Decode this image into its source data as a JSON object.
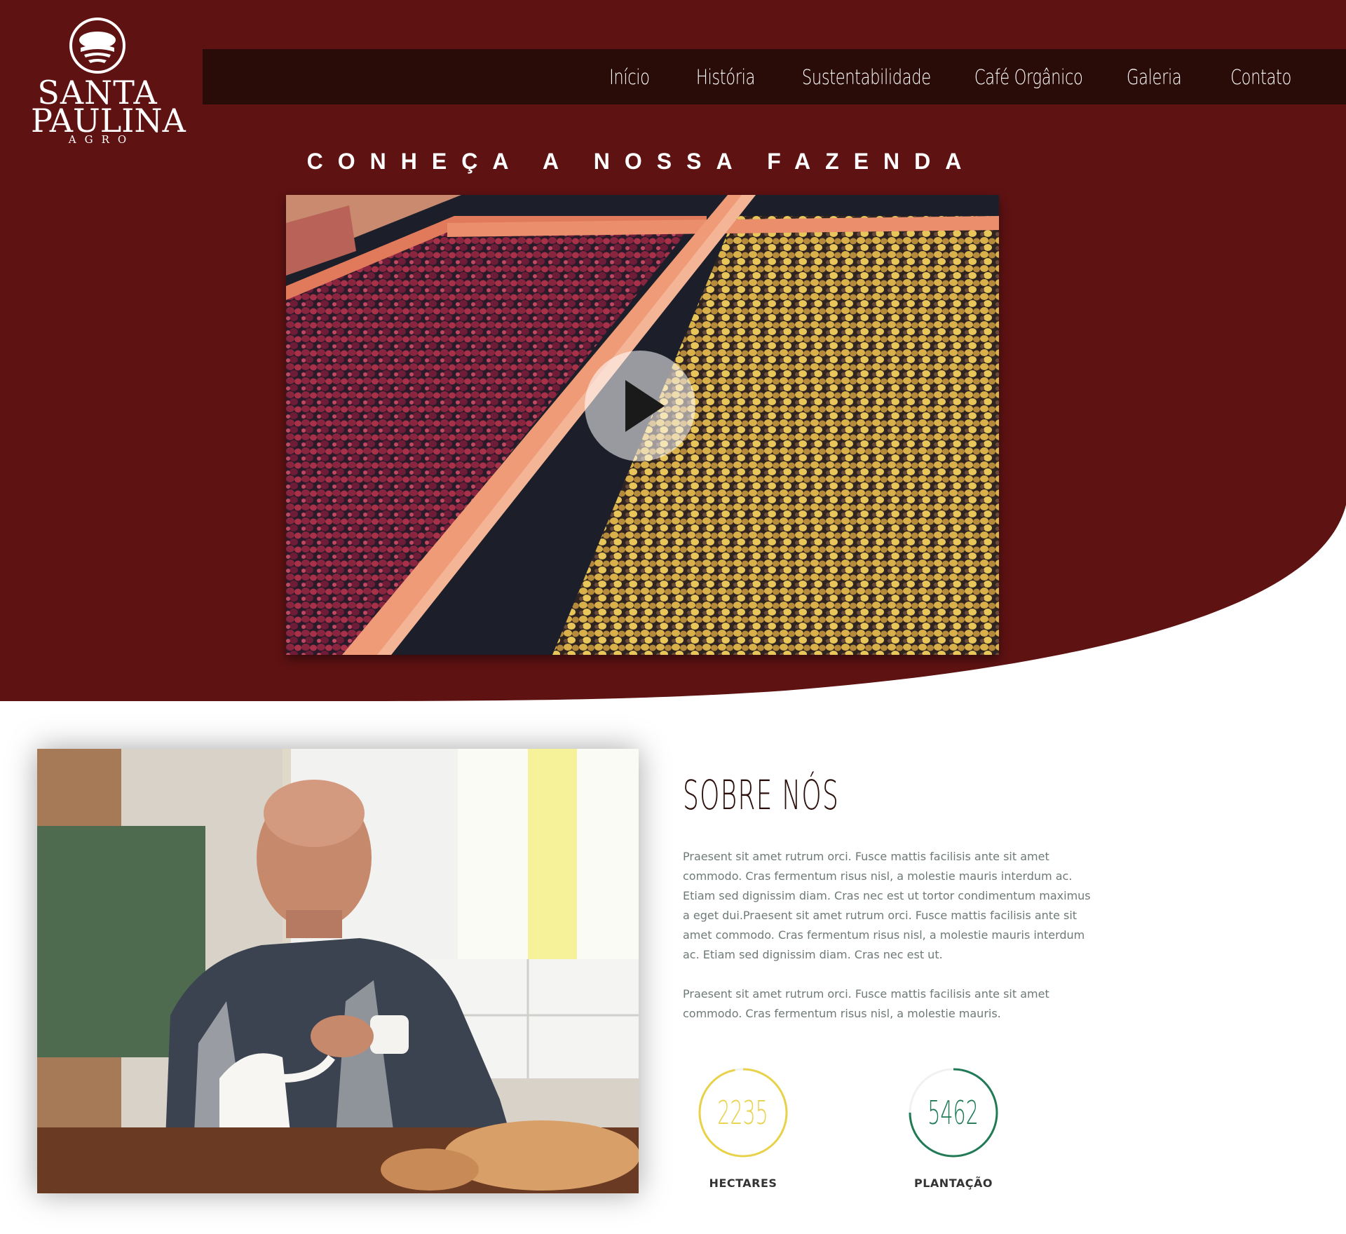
{
  "brand": {
    "line1": "SANTA",
    "line2": "PAULINA",
    "line3": "AGRO"
  },
  "nav": {
    "items": [
      {
        "label": "Início"
      },
      {
        "label": "História"
      },
      {
        "label": "Sustentabilidade"
      },
      {
        "label": "Café Orgânico"
      },
      {
        "label": "Galeria"
      },
      {
        "label": "Contato"
      }
    ]
  },
  "hero": {
    "title": "CONHEÇA A NOSSA FAZENDA",
    "video_icon": "play-icon"
  },
  "about": {
    "title": "SOBRE NÓS",
    "paragraphs": [
      "Praesent sit amet rutrum orci. Fusce mattis facilisis ante sit amet commodo. Cras fermentum risus nisl, a molestie mauris interdum ac. Etiam sed dignissim diam. Cras nec est ut tortor condimentum maximus a eget dui.Praesent sit amet rutrum orci. Fusce mattis facilisis ante sit amet commodo. Cras fermentum risus nisl, a molestie mauris interdum ac. Etiam sed dignissim diam. Cras nec est ut.",
      "Praesent sit amet rutrum orci. Fusce mattis facilisis ante sit amet commodo. Cras fermentum risus nisl, a molestie mauris."
    ],
    "stats": [
      {
        "value": "2235",
        "label": "HECTARES",
        "color": "#e8d24a",
        "progress": 0.97
      },
      {
        "value": "5462",
        "label": "PLANTAÇÃO",
        "color": "#1f7a55",
        "progress": 0.75
      }
    ]
  },
  "colors": {
    "hero_bg": "#5f1212",
    "navbar_bg": "#290c08",
    "title_dark": "#2a0f0b",
    "body_text": "#6e7a78"
  }
}
